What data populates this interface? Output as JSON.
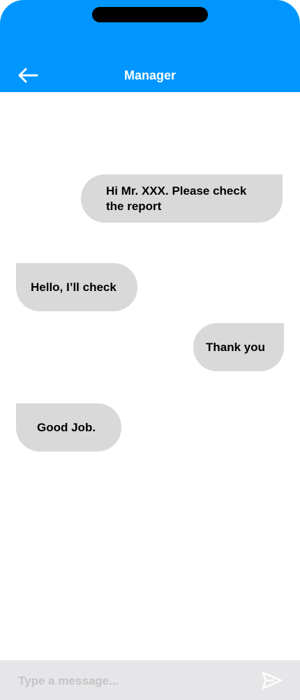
{
  "header": {
    "title": "Manager",
    "back_icon": "arrow-left-icon",
    "background": "#0096fe"
  },
  "messages": [
    {
      "sender": "me",
      "text": "Hi Mr. XXX. Please check the report"
    },
    {
      "sender": "other",
      "text": "Hello, I’ll check"
    },
    {
      "sender": "me",
      "text": "Thank you"
    },
    {
      "sender": "other",
      "text": "Good Job."
    }
  ],
  "composer": {
    "value": "",
    "placeholder": "Type a message...",
    "send_icon": "send-icon"
  },
  "colors": {
    "bubble": "#d9d9d9",
    "composer_bg": "#e6e6e8",
    "placeholder": "#c4c4c6"
  }
}
